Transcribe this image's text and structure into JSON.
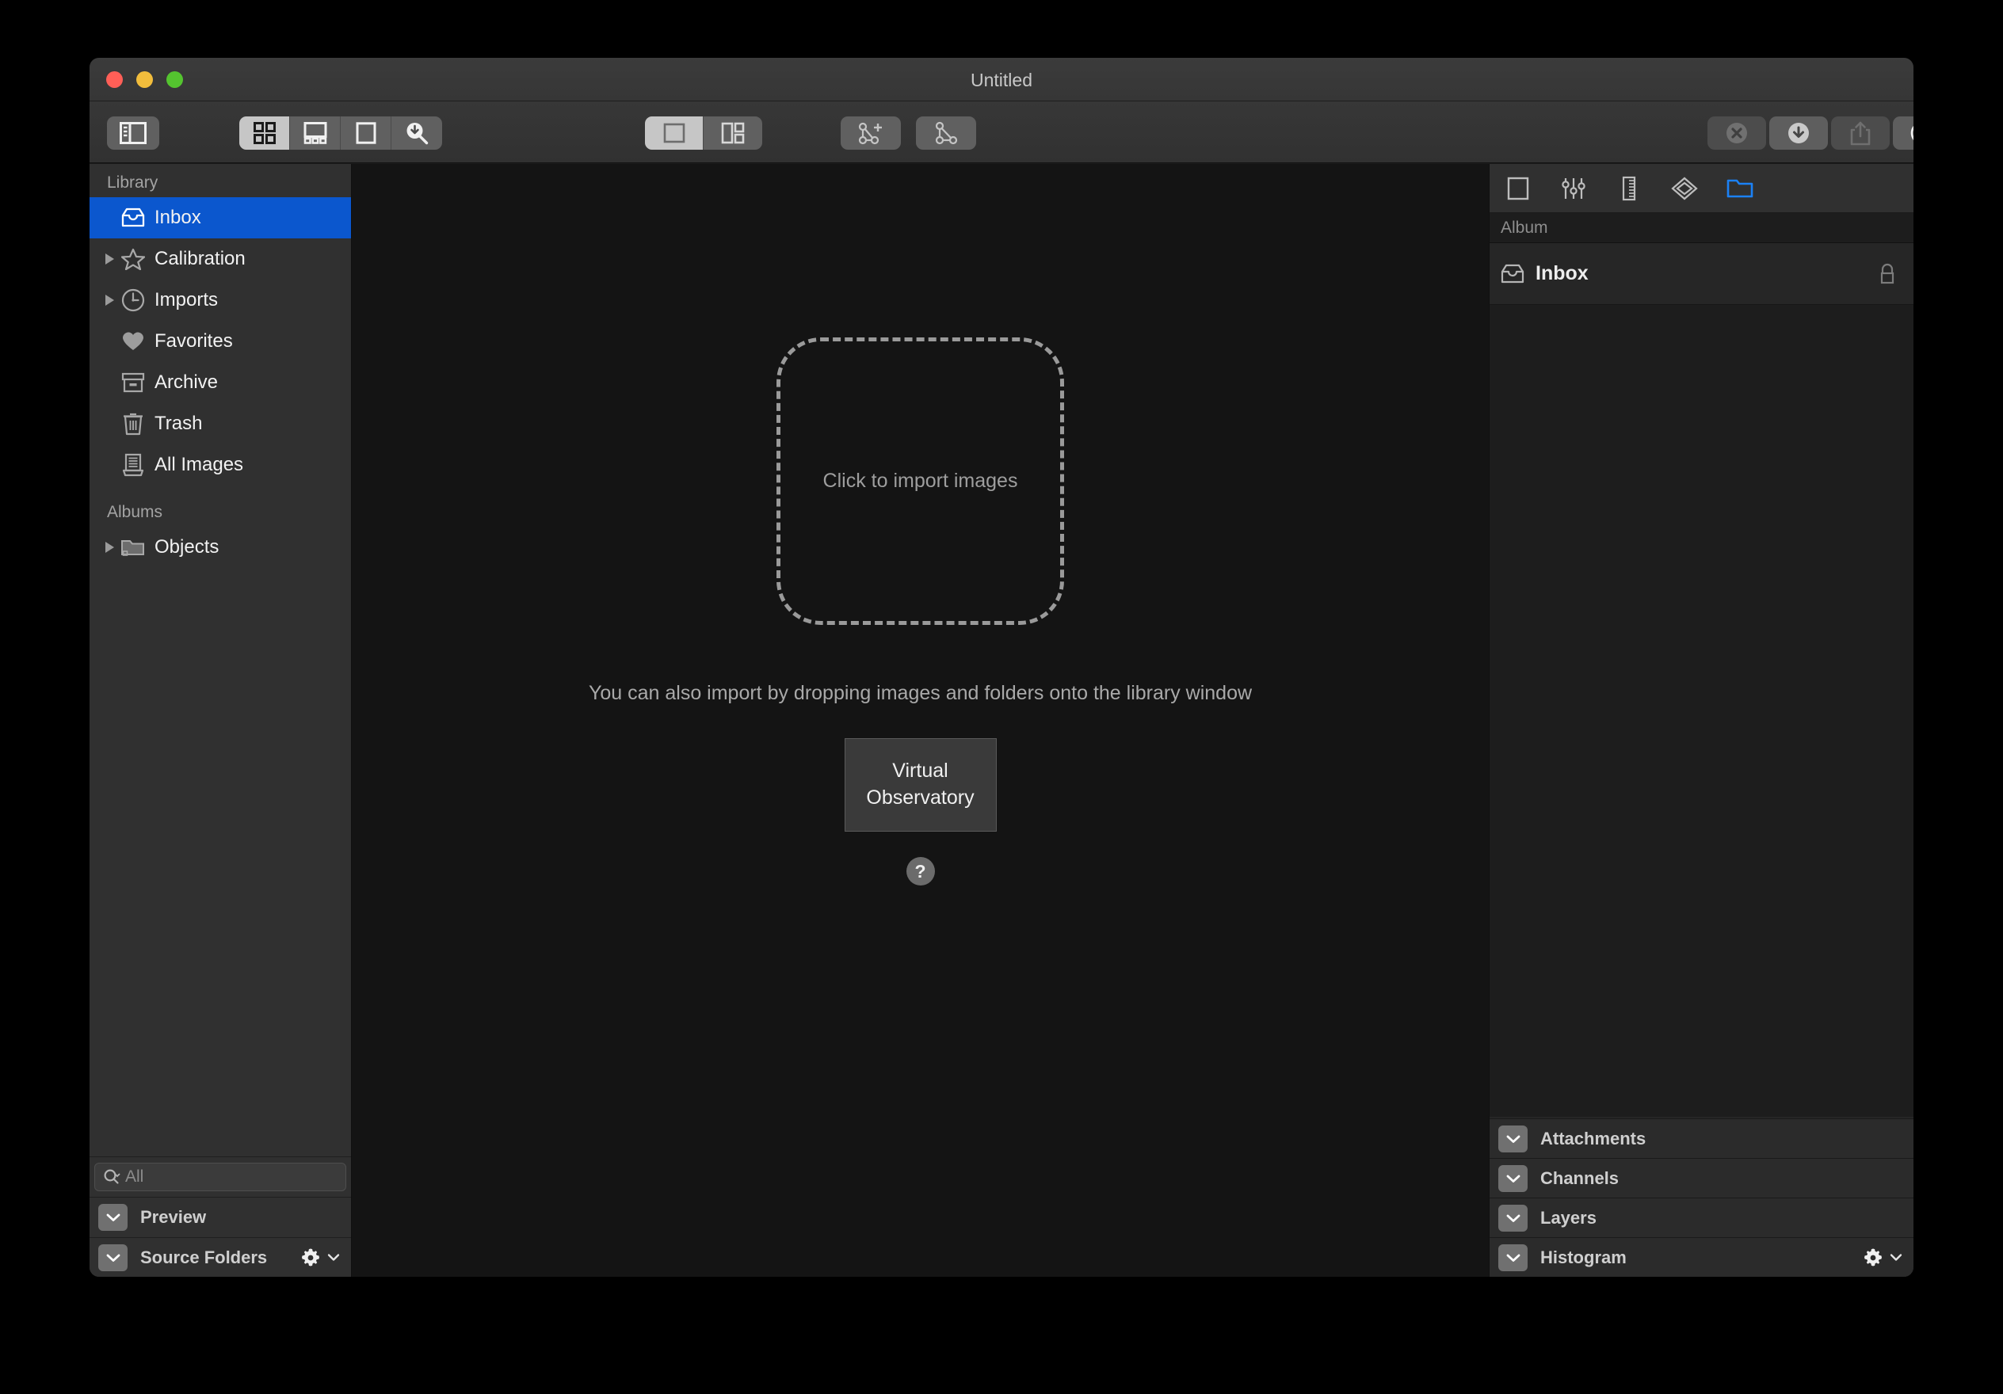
{
  "window": {
    "title": "Untitled",
    "traffic_lights": [
      "close",
      "minimize",
      "zoom"
    ]
  },
  "toolbar": {
    "sidebar_toggle": "sidebar-toggle",
    "view_modes": [
      {
        "name": "grid-view",
        "selected": true
      },
      {
        "name": "filmstrip-view",
        "selected": false
      },
      {
        "name": "single-image-view",
        "selected": false
      },
      {
        "name": "search-view",
        "selected": false
      }
    ],
    "layout_modes": [
      {
        "name": "single-pane-layout",
        "selected": true
      },
      {
        "name": "split-pane-layout",
        "selected": false
      }
    ],
    "plate_solve_add": "plate-solve-add",
    "plate_solve": "plate-solve",
    "right_actions": [
      {
        "name": "cancel-button",
        "enabled": false
      },
      {
        "name": "download-button",
        "enabled": true
      },
      {
        "name": "share-button",
        "enabled": false
      },
      {
        "name": "info-button",
        "enabled": true
      }
    ]
  },
  "sidebar": {
    "library_header": "Library",
    "library_items": [
      {
        "label": "Inbox",
        "icon": "inbox-icon",
        "selected": true,
        "disclosure": false
      },
      {
        "label": "Calibration",
        "icon": "star-icon",
        "selected": false,
        "disclosure": true
      },
      {
        "label": "Imports",
        "icon": "clock-icon",
        "selected": false,
        "disclosure": true
      },
      {
        "label": "Favorites",
        "icon": "heart-icon",
        "selected": false,
        "disclosure": false
      },
      {
        "label": "Archive",
        "icon": "archive-icon",
        "selected": false,
        "disclosure": false
      },
      {
        "label": "Trash",
        "icon": "trash-icon",
        "selected": false,
        "disclosure": false
      },
      {
        "label": "All Images",
        "icon": "all-images-icon",
        "selected": false,
        "disclosure": false
      }
    ],
    "albums_header": "Albums",
    "album_items": [
      {
        "label": "Objects",
        "icon": "folder-locked-icon",
        "selected": false,
        "disclosure": true
      }
    ],
    "search": {
      "placeholder": "All",
      "value": ""
    },
    "panels": [
      {
        "label": "Preview",
        "collapsed": true,
        "gear": false
      },
      {
        "label": "Source Folders",
        "collapsed": true,
        "gear": true
      }
    ],
    "selection_color": "#0b57ce"
  },
  "main": {
    "dropzone_label": "Click to import images",
    "hint": "You can also import by dropping images and folders onto the library window",
    "vo_button_line1": "Virtual",
    "vo_button_line2": "Observatory",
    "help_label": "?"
  },
  "inspector": {
    "tabs": [
      {
        "name": "image-tab",
        "active": false
      },
      {
        "name": "adjust-tab",
        "active": false
      },
      {
        "name": "metadata-tab",
        "active": false
      },
      {
        "name": "layers-tab",
        "active": false
      },
      {
        "name": "album-tab",
        "active": true,
        "color": "#1b81f5"
      }
    ],
    "subheader": "Album",
    "item": {
      "label": "Inbox",
      "icon": "inbox-icon",
      "lock": "lock-icon"
    },
    "sections": [
      {
        "label": "Attachments",
        "collapsed": true,
        "gear": false
      },
      {
        "label": "Channels",
        "collapsed": true,
        "gear": false
      },
      {
        "label": "Layers",
        "collapsed": true,
        "gear": false
      },
      {
        "label": "Histogram",
        "collapsed": true,
        "gear": true
      }
    ]
  }
}
